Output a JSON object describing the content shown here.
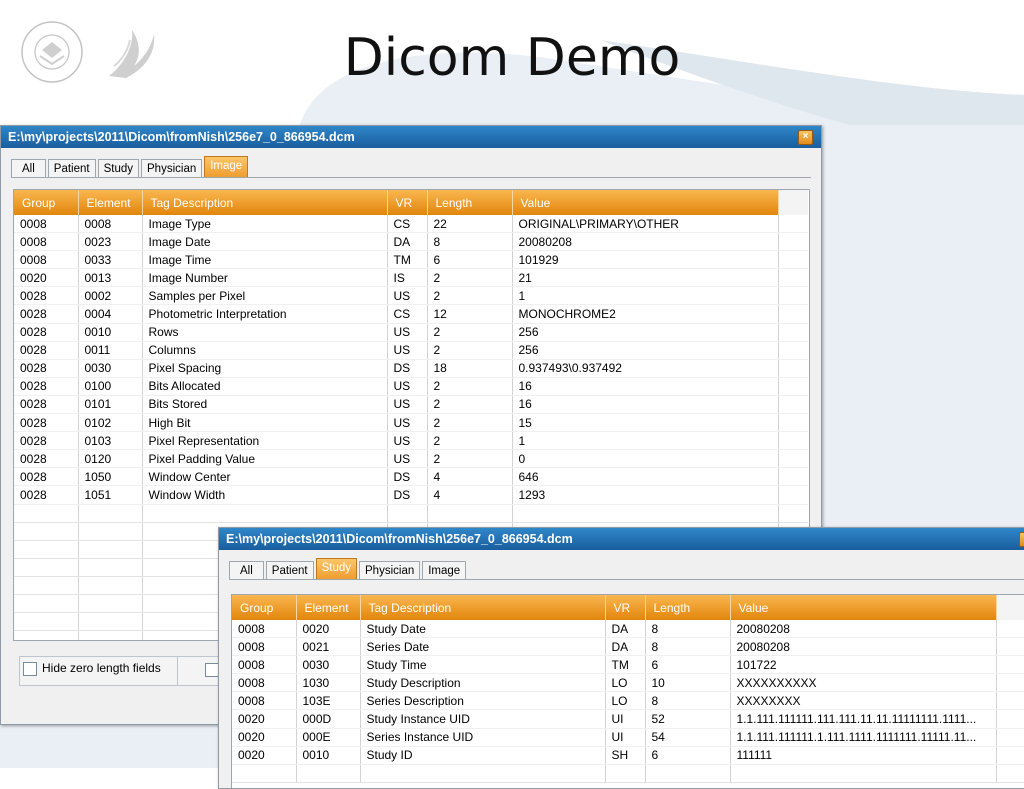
{
  "slide": {
    "title": "Dicom Demo"
  },
  "window1": {
    "title": "E:\\my\\projects\\2011\\Dicom\\fromNish\\256e7_0_866954.dcm",
    "tabs": [
      "All",
      "Patient",
      "Study",
      "Physician",
      "Image"
    ],
    "active_tab": "Image",
    "columns": [
      "Group",
      "Element",
      "Tag Description",
      "VR",
      "Length",
      "Value"
    ],
    "rows": [
      [
        "0008",
        "0008",
        "Image Type",
        "CS",
        "22",
        "ORIGINAL\\PRIMARY\\OTHER"
      ],
      [
        "0008",
        "0023",
        "Image Date",
        "DA",
        "8",
        "20080208"
      ],
      [
        "0008",
        "0033",
        "Image Time",
        "TM",
        "6",
        "101929"
      ],
      [
        "0020",
        "0013",
        "Image Number",
        "IS",
        "2",
        "21"
      ],
      [
        "0028",
        "0002",
        "Samples per Pixel",
        "US",
        "2",
        "1"
      ],
      [
        "0028",
        "0004",
        "Photometric Interpretation",
        "CS",
        "12",
        "MONOCHROME2"
      ],
      [
        "0028",
        "0010",
        "Rows",
        "US",
        "2",
        "256"
      ],
      [
        "0028",
        "0011",
        "Columns",
        "US",
        "2",
        "256"
      ],
      [
        "0028",
        "0030",
        "Pixel Spacing",
        "DS",
        "18",
        "0.937493\\0.937492"
      ],
      [
        "0028",
        "0100",
        "Bits Allocated",
        "US",
        "2",
        "16"
      ],
      [
        "0028",
        "0101",
        "Bits Stored",
        "US",
        "2",
        "16"
      ],
      [
        "0028",
        "0102",
        "High Bit",
        "US",
        "2",
        "15"
      ],
      [
        "0028",
        "0103",
        "Pixel Representation",
        "US",
        "2",
        "1"
      ],
      [
        "0028",
        "0120",
        "Pixel Padding Value",
        "US",
        "2",
        "0"
      ],
      [
        "0028",
        "1050",
        "Window Center",
        "DS",
        "4",
        "646"
      ],
      [
        "0028",
        "1051",
        "Window Width",
        "DS",
        "4",
        "1293"
      ]
    ],
    "hide_zero_label": "Hide zero length fields"
  },
  "window2": {
    "title": "E:\\my\\projects\\2011\\Dicom\\fromNish\\256e7_0_866954.dcm",
    "tabs": [
      "All",
      "Patient",
      "Study",
      "Physician",
      "Image"
    ],
    "active_tab": "Study",
    "columns": [
      "Group",
      "Element",
      "Tag Description",
      "VR",
      "Length",
      "Value"
    ],
    "rows": [
      [
        "0008",
        "0020",
        "Study Date",
        "DA",
        "8",
        "20080208"
      ],
      [
        "0008",
        "0021",
        "Series Date",
        "DA",
        "8",
        "20080208"
      ],
      [
        "0008",
        "0030",
        "Study Time",
        "TM",
        "6",
        "101722"
      ],
      [
        "0008",
        "1030",
        "Study Description",
        "LO",
        "10",
        "XXXXXXXXXX"
      ],
      [
        "0008",
        "103E",
        "Series Description",
        "LO",
        "8",
        "XXXXXXXX"
      ],
      [
        "0020",
        "000D",
        "Study Instance UID",
        "UI",
        "52",
        "1.1.111.111111.111.111.11.11.11111111.1111..."
      ],
      [
        "0020",
        "000E",
        "Series Instance UID",
        "UI",
        "54",
        "1.1.111.111111.1.111.1111.1111111.11111.11..."
      ],
      [
        "0020",
        "0010",
        "Study ID",
        "SH",
        "6",
        "111111"
      ]
    ]
  },
  "colors": {
    "accent": "#ee9b2c",
    "titlebar": "#1a5d9e",
    "swoosh": "#e6edf3"
  },
  "icons": [
    "nih-seal-icon",
    "hhs-eagle-icon",
    "close-icon",
    "checkbox-icon"
  ]
}
